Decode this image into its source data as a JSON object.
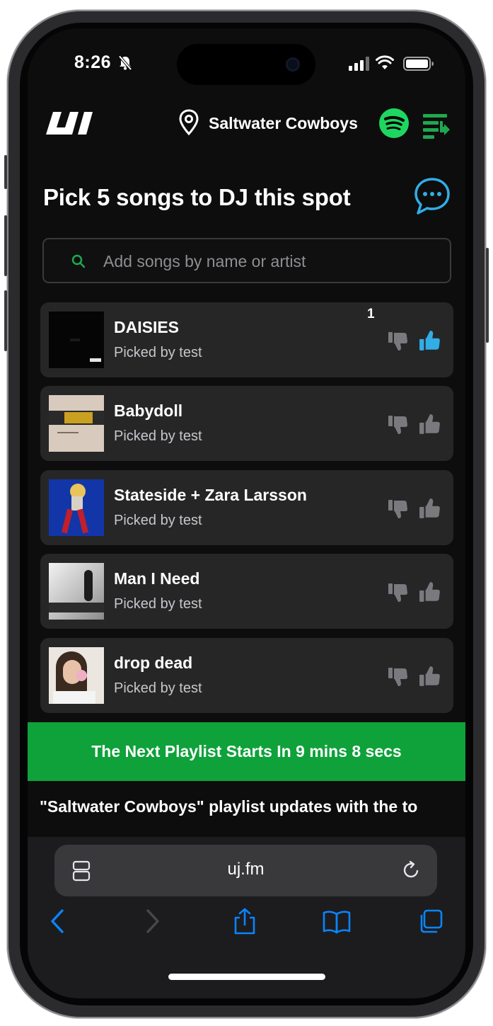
{
  "status_bar": {
    "time": "8:26"
  },
  "header": {
    "venue_name": "Saltwater Cowboys"
  },
  "page_title": "Pick 5 songs to DJ this spot",
  "search": {
    "placeholder": "Add songs by name or artist",
    "value": ""
  },
  "songs": [
    {
      "title": "DAISIES",
      "picked_by": "Picked by test",
      "vote_count": "1",
      "liked": true
    },
    {
      "title": "Babydoll",
      "picked_by": "Picked by test",
      "vote_count": "",
      "liked": false
    },
    {
      "title": "Stateside + Zara Larsson",
      "picked_by": "Picked by test",
      "vote_count": "",
      "liked": false
    },
    {
      "title": "Man I Need",
      "picked_by": "Picked by test",
      "vote_count": "",
      "liked": false
    },
    {
      "title": "drop dead",
      "picked_by": "Picked by test",
      "vote_count": "",
      "liked": false
    }
  ],
  "countdown_banner": "The Next Playlist Starts In 9 mins 8 secs",
  "marquee_text": "\"Saltwater Cowboys\" playlist updates with the to",
  "browser": {
    "url": "uj.fm"
  },
  "colors": {
    "accent_green": "#0fa13a",
    "spotify_green": "#1ed760",
    "link_blue": "#32ade6",
    "background": "#0d0d0d",
    "card": "#262627"
  },
  "icons": {
    "logo": "uj-logo",
    "location": "location-pin-icon",
    "spotify": "spotify-icon",
    "queue": "queue-icon",
    "chat": "chat-bubble-icon",
    "search": "search-icon",
    "dislike": "thumbs-down-icon",
    "like": "thumbs-up-icon"
  }
}
